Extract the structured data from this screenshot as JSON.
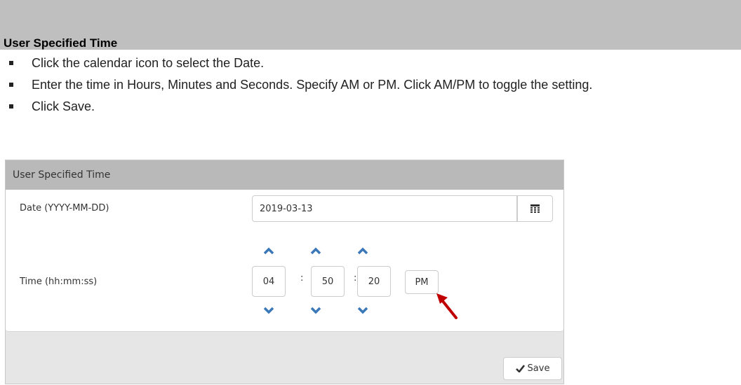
{
  "doc": {
    "section_title": "User Specified Time",
    "bullets": [
      "Click the calendar icon to select the Date.",
      "Enter the time in Hours, Minutes and Seconds. Specify AM or PM. Click AM/PM to toggle the setting.",
      "Click Save."
    ]
  },
  "panel": {
    "title": "User Specified Time",
    "date_label": "Date (YYYY-MM-DD)",
    "date_value": "2019-03-13",
    "time_label": "Time (hh:mm:ss)",
    "hours": "04",
    "minutes": "50",
    "seconds": "20",
    "separator": ":",
    "ampm": "PM",
    "save_label": "Save",
    "icons": {
      "calendar": "calendar-icon",
      "increment": "chevron-up-icon",
      "decrement": "chevron-down-icon",
      "save": "checkmark-icon",
      "annotation": "red-arrow-icon"
    },
    "colors": {
      "chevron": "#3a78b8",
      "arrow": "#c00000",
      "header": "#b9b9b9",
      "banner": "#bfbfbf"
    }
  }
}
